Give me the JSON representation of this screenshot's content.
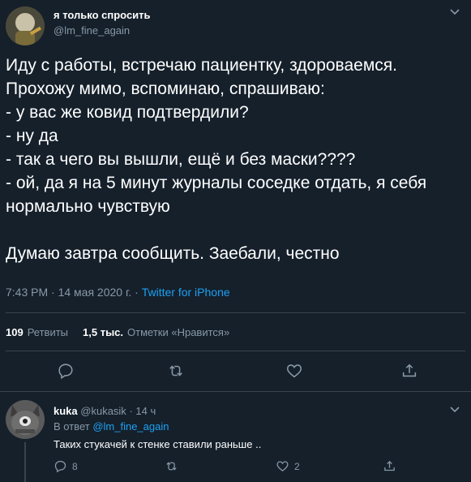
{
  "tweet": {
    "author_name": "я только спросить",
    "author_handle": "@lm_fine_again",
    "text": "Иду с работы, встречаю пациентку, здороваемся.\nПрохожу мимо, вспоминаю, спрашиваю:\n- у вас же ковид подтвердили?\n- ну да\n- так а чего вы вышли, ещё и без маски????\n- ой, да я на 5 минут журналы соседке отдать, я себя нормально чувствую\n\nДумаю завтра сообщить. Заебали, честно",
    "timestamp": "7:43 PM · 14 мая 2020 г.",
    "separator": " · ",
    "source": "Twitter for iPhone",
    "retweets_count": "109",
    "retweets_label": "Ретвиты",
    "likes_count": "1,5 тыс.",
    "likes_label": "Отметки «Нравится»"
  },
  "reply": {
    "author_name": "kuka",
    "author_handle": "@kukasik",
    "time": "· 14 ч",
    "reply_to_prefix": "В ответ",
    "reply_to_handle": "@lm_fine_again",
    "text": "Таких стукачей к стенке ставили раньше ..",
    "reply_count": "8",
    "like_count": "2"
  },
  "icons": {
    "reply": "reply-icon",
    "retweet": "retweet-icon",
    "like": "heart-icon",
    "share": "share-icon",
    "more": "chevron-down-icon"
  },
  "colors": {
    "background": "#15202b",
    "muted": "#8899a6",
    "accent": "#1da1f2",
    "divider": "#38444d"
  }
}
